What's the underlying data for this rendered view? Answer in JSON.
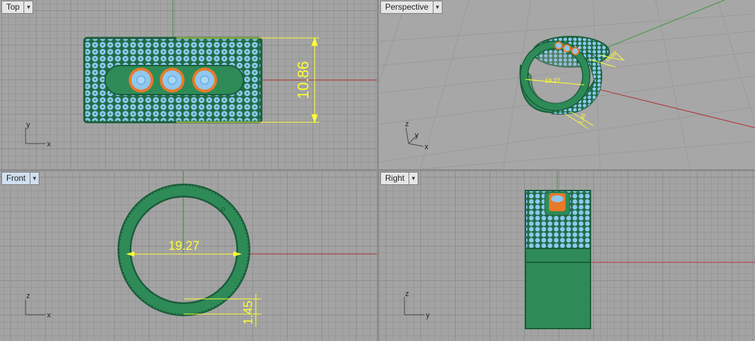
{
  "viewports": {
    "top": {
      "label": "Top",
      "axis_x": "x",
      "axis_y": "y",
      "dimension": "10.86"
    },
    "perspective": {
      "label": "Perspective",
      "axis_x": "x",
      "axis_y": "y",
      "axis_z": "z",
      "dimension_inner": "19.27",
      "dimension_width": "10.86",
      "dimension_thickness": "1.45"
    },
    "front": {
      "label": "Front",
      "axis_x": "x",
      "axis_z": "z",
      "dimension_inner": "19.27",
      "dimension_thickness": "1.45"
    },
    "right": {
      "label": "Right",
      "axis_y": "y",
      "axis_z": "z"
    }
  },
  "colors": {
    "ring_green": "#2e8b57",
    "pave_blue": "#8ec8f0",
    "gem_orange": "#e87a2a",
    "dimension_yellow": "#ffff33",
    "x_axis": "#b03030",
    "y_axis": "#3a9a3a"
  },
  "icons": {
    "dropdown": "chevron-down-icon"
  }
}
